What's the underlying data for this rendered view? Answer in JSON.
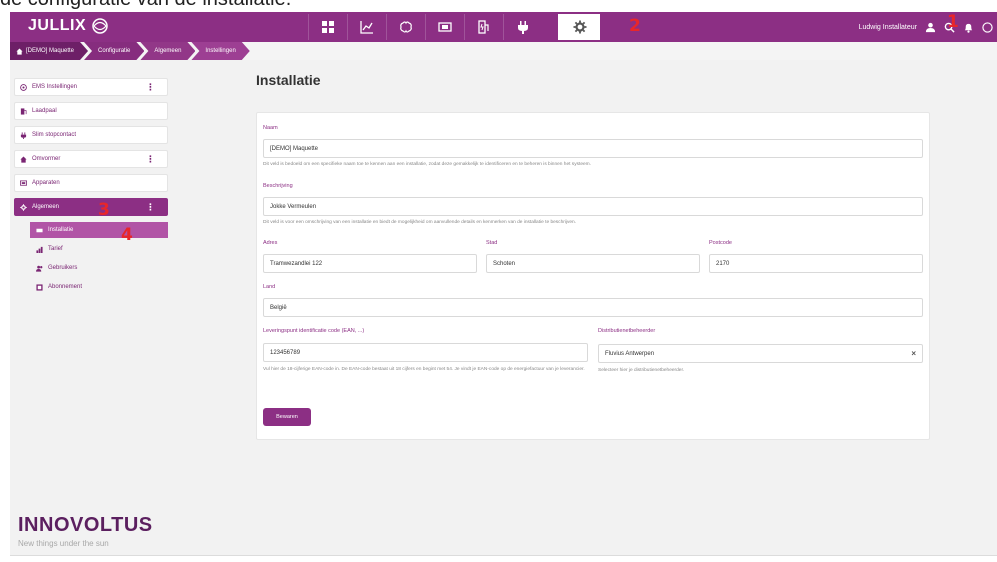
{
  "caption": "de configuratie van de installatie.",
  "app": {
    "logo": "JULLIX"
  },
  "topnav": {
    "items": [
      {
        "name": "dashboard",
        "active": false
      },
      {
        "name": "charts",
        "active": false
      },
      {
        "name": "brain",
        "active": false
      },
      {
        "name": "battery",
        "active": false
      },
      {
        "name": "ev-charger",
        "active": false
      },
      {
        "name": "plug",
        "active": false
      },
      {
        "name": "settings",
        "active": true
      }
    ]
  },
  "annotations": {
    "n1": "1",
    "n2": "2",
    "n3": "3",
    "n4": "4"
  },
  "user": {
    "name": "Ludwig Installateur"
  },
  "breadcrumb": [
    "[DEMO] Maquette",
    "Configuratie",
    "Algemeen",
    "Instellingen"
  ],
  "sidebar": {
    "items": [
      {
        "label": "EMS Instellingen",
        "icon": "ems-icon",
        "kebab": true,
        "active": false
      },
      {
        "label": "Laadpaal",
        "icon": "charger-icon",
        "kebab": false,
        "active": false
      },
      {
        "label": "Slim stopcontact",
        "icon": "plug-icon",
        "kebab": false,
        "active": false
      },
      {
        "label": "Omvormer",
        "icon": "inverter-icon",
        "kebab": true,
        "active": false
      },
      {
        "label": "Apparaten",
        "icon": "devices-icon",
        "kebab": false,
        "active": false
      },
      {
        "label": "Algemeen",
        "icon": "gear-icon",
        "kebab": true,
        "active": true
      }
    ],
    "subitems": [
      {
        "label": "Installatie",
        "icon": "installation-icon",
        "active": true
      },
      {
        "label": "Tarief",
        "icon": "tariff-icon",
        "active": false
      },
      {
        "label": "Gebruikers",
        "icon": "users-icon",
        "active": false
      },
      {
        "label": "Abonnement",
        "icon": "subscription-icon",
        "active": false
      }
    ]
  },
  "brand": {
    "name": "INNOVOLTUS",
    "tagline": "New things under the sun"
  },
  "page": {
    "title": "Installatie"
  },
  "form": {
    "name": {
      "label": "Naam",
      "value": "[DEMO] Maquette",
      "help": "Dit veld is bedoeld om een specifieke naam toe te kennen aan een installatie, zodat deze gemakkelijk te identificeren en te beheren is binnen het systeem."
    },
    "description": {
      "label": "Beschrijving",
      "value": "Jokke Vermeulen",
      "help": "Dit veld is voor een omschrijving van een installatie en biedt de mogelijkheid om aanvullende details en kenmerken van de installatie te beschrijven."
    },
    "address": {
      "label": "Adres",
      "value": "Tramwezandlei 122"
    },
    "city": {
      "label": "Stad",
      "value": "Schoten"
    },
    "postcode": {
      "label": "Postcode",
      "value": "2170"
    },
    "country": {
      "label": "Land",
      "value": "België"
    },
    "ean": {
      "label": "Leveringspunt identificatie code (EAN, ...)",
      "value": "123456789",
      "help": "Vul hier de 18-cijferige EAN-code in. De EAN-code bestaat uit 18 cijfers en begint met 54. Je vindt je EAN-code op de energiefactuur van je leverancier."
    },
    "dso": {
      "label": "Distributienetbeheerder",
      "value": "Fluvius Antwerpen",
      "help": "Selecteer hier je distributienetbeheerder."
    },
    "save_label": "Bewaren"
  }
}
